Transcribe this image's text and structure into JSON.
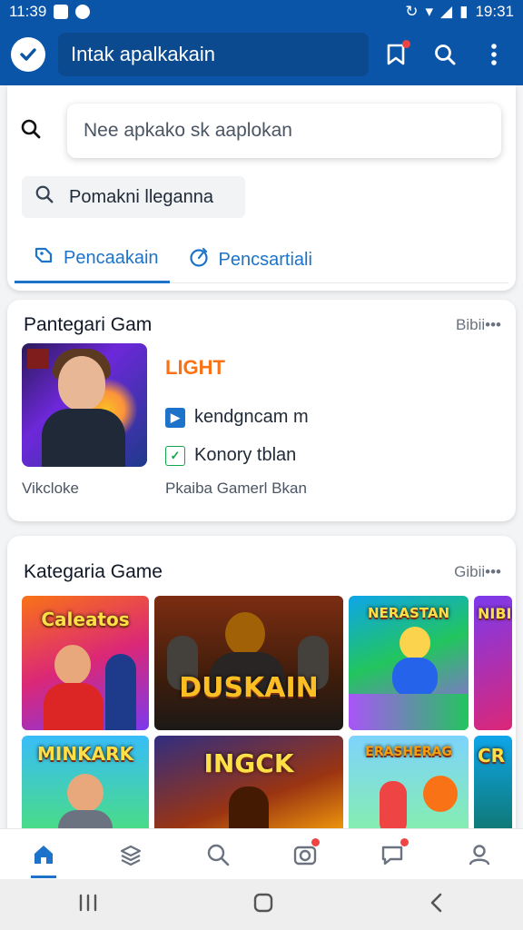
{
  "status_bar": {
    "time_left": "11:39",
    "time_right": "19:31"
  },
  "app_bar": {
    "title": "Intak apalkakain"
  },
  "search": {
    "placeholder": "Nee apkako sk aaplokan"
  },
  "recent_chip": {
    "label": "Pomakni lleganna"
  },
  "tabs": [
    {
      "label": "Pencaakain",
      "active": true
    },
    {
      "label": "Pencsartiali",
      "active": false
    }
  ],
  "featured": {
    "title": "Pantegari Gam",
    "more": "Bibii•••",
    "badge": "LIGHT",
    "rows": [
      {
        "label": "kendgncam m",
        "icon": "play-store-icon"
      },
      {
        "label": "Konory tblan",
        "icon": "check-icon"
      }
    ],
    "footer_left": "Vikcloke",
    "footer_right": "Pkaiba Gamerl Bkan"
  },
  "categories": {
    "title": "Kategaria Game",
    "more": "Gibii•••",
    "tiles": [
      {
        "label": "Caleatos"
      },
      {
        "label": "DUSKAIN"
      },
      {
        "label": "NERASTAN"
      },
      {
        "label": "NIBI"
      },
      {
        "label": "MINKARK"
      },
      {
        "label": "INGCK"
      },
      {
        "label": "ERASHERAG"
      },
      {
        "label": "CR"
      }
    ]
  },
  "colors": {
    "primary": "#0a55a8",
    "accent": "#1d73c9",
    "badge": "#f97316"
  }
}
